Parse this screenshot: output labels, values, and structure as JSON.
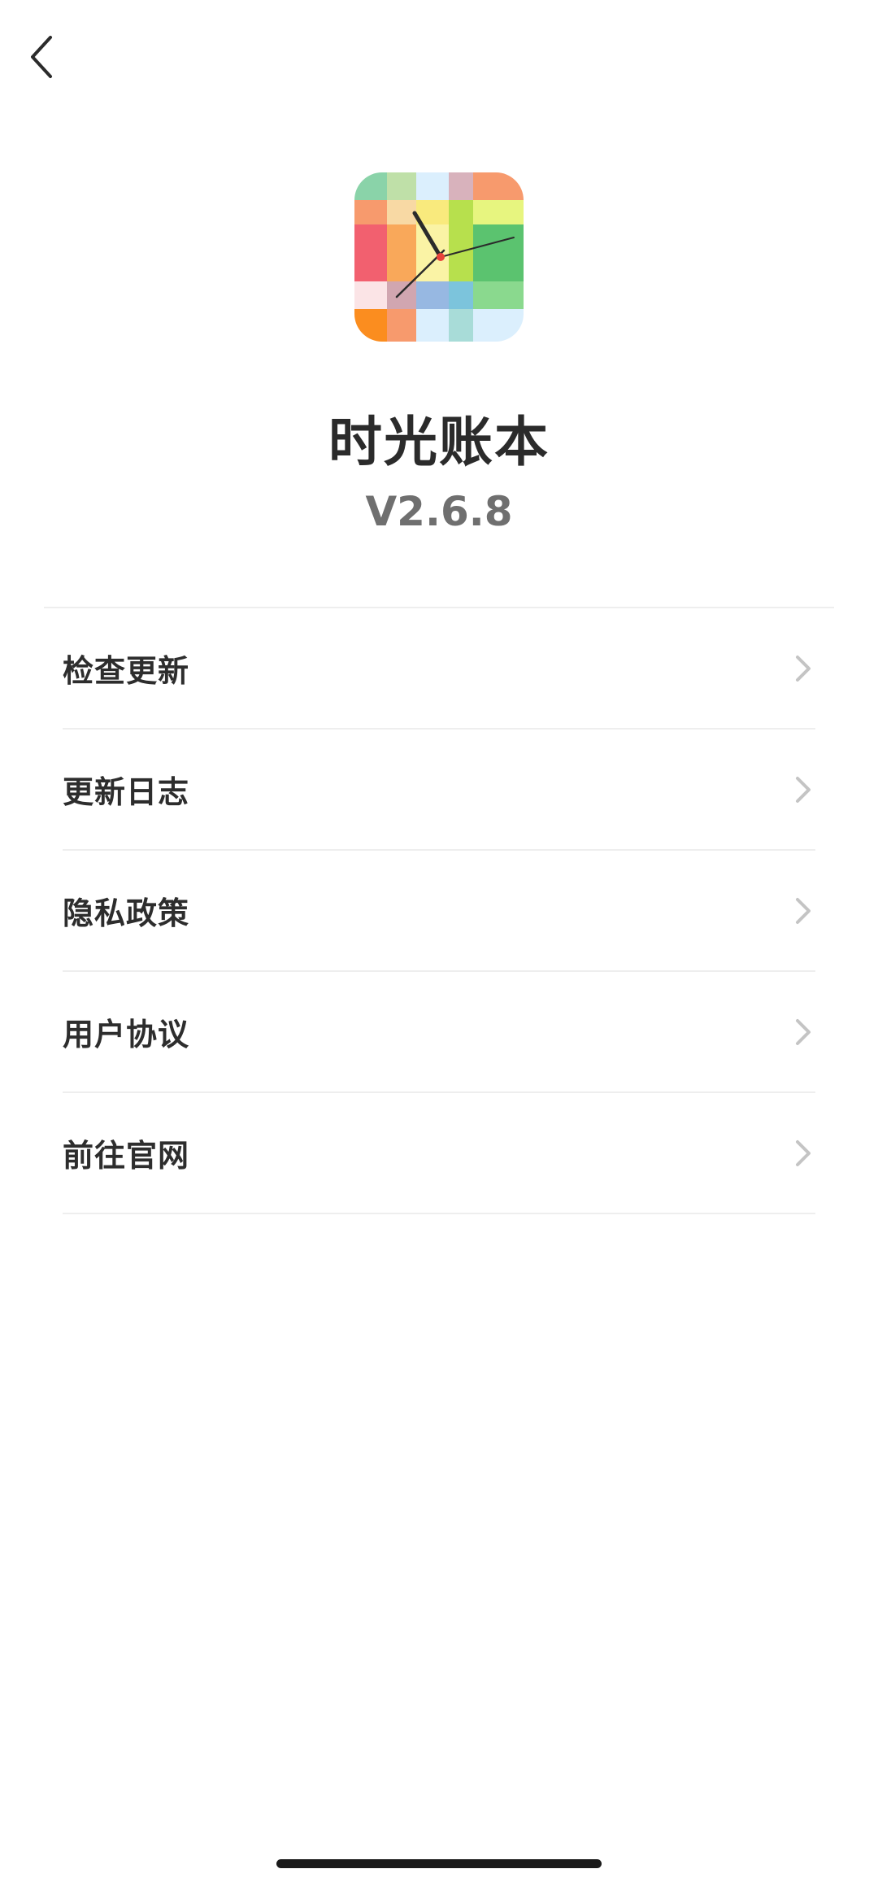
{
  "header": {
    "back_icon": "chevron-left-icon"
  },
  "app": {
    "name": "时光账本",
    "version": "V2.6.8",
    "icon": "clock-mosaic-app-icon",
    "icon_colors": {
      "green": "#8ad3a9",
      "orange": "#f79a6d",
      "red": "#f2606f",
      "yellow": "#f9ea7d",
      "lime": "#b7e04d",
      "blue": "#97b8e2",
      "sky": "#dbeffd"
    }
  },
  "menu": {
    "items": [
      {
        "label": "检查更新",
        "icon": "chevron-right-icon"
      },
      {
        "label": "更新日志",
        "icon": "chevron-right-icon"
      },
      {
        "label": "隐私政策",
        "icon": "chevron-right-icon"
      },
      {
        "label": "用户协议",
        "icon": "chevron-right-icon"
      },
      {
        "label": "前往官网",
        "icon": "chevron-right-icon"
      }
    ]
  },
  "colors": {
    "text_primary": "#2d2d2d",
    "text_secondary": "#6f6f6f",
    "divider": "#eeeeee",
    "chevron": "#c4c4c4"
  }
}
